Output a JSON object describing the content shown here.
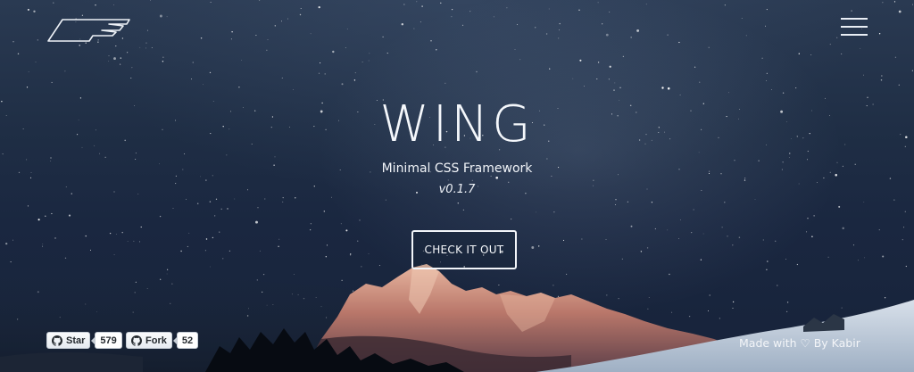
{
  "colors": {
    "accent": "#ffffff",
    "sky_top": "#2a3a52",
    "sky_bottom": "#17233a",
    "mountain_glow": "#c98a72"
  },
  "header": {
    "logo_icon": "wing-logo-icon",
    "menu_icon": "hamburger-menu-icon"
  },
  "hero": {
    "title": "WING",
    "tagline": "Minimal CSS Framework",
    "version": "v0.1.7",
    "cta_label": "CHECK IT OUT"
  },
  "github": {
    "star_label": "Star",
    "star_count": "579",
    "fork_label": "Fork",
    "fork_count": "52",
    "icon": "github-icon"
  },
  "footer": {
    "credit": "Made with ♡ By Kabir"
  }
}
